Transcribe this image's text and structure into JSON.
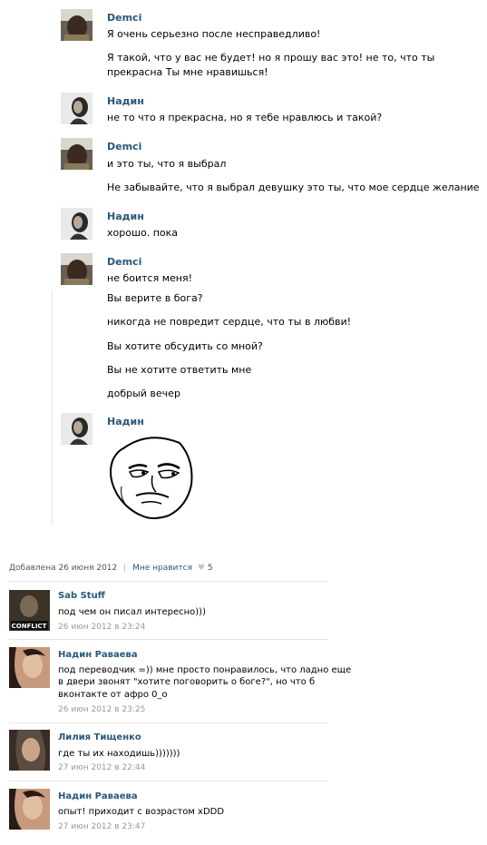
{
  "chat": {
    "m1": {
      "author": "Demci",
      "lines": [
        "Я очень серьезно после несправедливо!"
      ]
    },
    "m1b": {
      "lines": [
        "Я такой, что у вас не будет! но я прошу вас это! не то, что ты",
        "прекрасна Ты мне нравишься!"
      ]
    },
    "m2": {
      "author": "Надин",
      "lines": [
        "не то что я прекрасна, но я тебе нравлюсь и такой?"
      ]
    },
    "m3": {
      "author": "Demci",
      "lines": [
        "и это ты, что я выбрал",
        "Не забывайте, что я выбрал девушку это ты, что мое сердце желание"
      ]
    },
    "m4": {
      "author": "Надин",
      "lines": [
        "хорошо. пока"
      ]
    },
    "m5": {
      "author": "Demci",
      "lines": [
        "не боится меня!",
        "Вы верите в бога?",
        "никогда не повредит сердце, что ты в любви!",
        "Вы хотите обсудить со мной?",
        "Вы не хотите ответить мне",
        "добрый вечер"
      ]
    },
    "m6": {
      "author": "Надин"
    }
  },
  "post": {
    "added": "Добавлена 26 июня 2012",
    "divider": "|",
    "like_label": "Мне нравится",
    "likes": "5"
  },
  "comments": [
    {
      "author": "Sab Stuff",
      "lines": [
        "под чем он писал интересно)))"
      ],
      "date": "26 июн 2012 в 23:24",
      "avatar_text": "CONFLICT"
    },
    {
      "author": "Надин Раваева",
      "lines": [
        "под переводчик =)) мне просто понравилось, что ладно еще",
        "в двери звонят \"хотите поговорить о боге?\", но что б",
        "вконтакте от афро 0_о"
      ],
      "date": "26 июн 2012 в 23:25"
    },
    {
      "author": "Лилия Тищенко",
      "lines": [
        "где ты их находишь)))))))"
      ],
      "date": "27 июн 2012 в 22:44"
    },
    {
      "author": "Надин Раваева",
      "lines": [
        "опыт! приходит с возрастом xDDD"
      ],
      "date": "27 июн 2012 в 23:47"
    }
  ]
}
